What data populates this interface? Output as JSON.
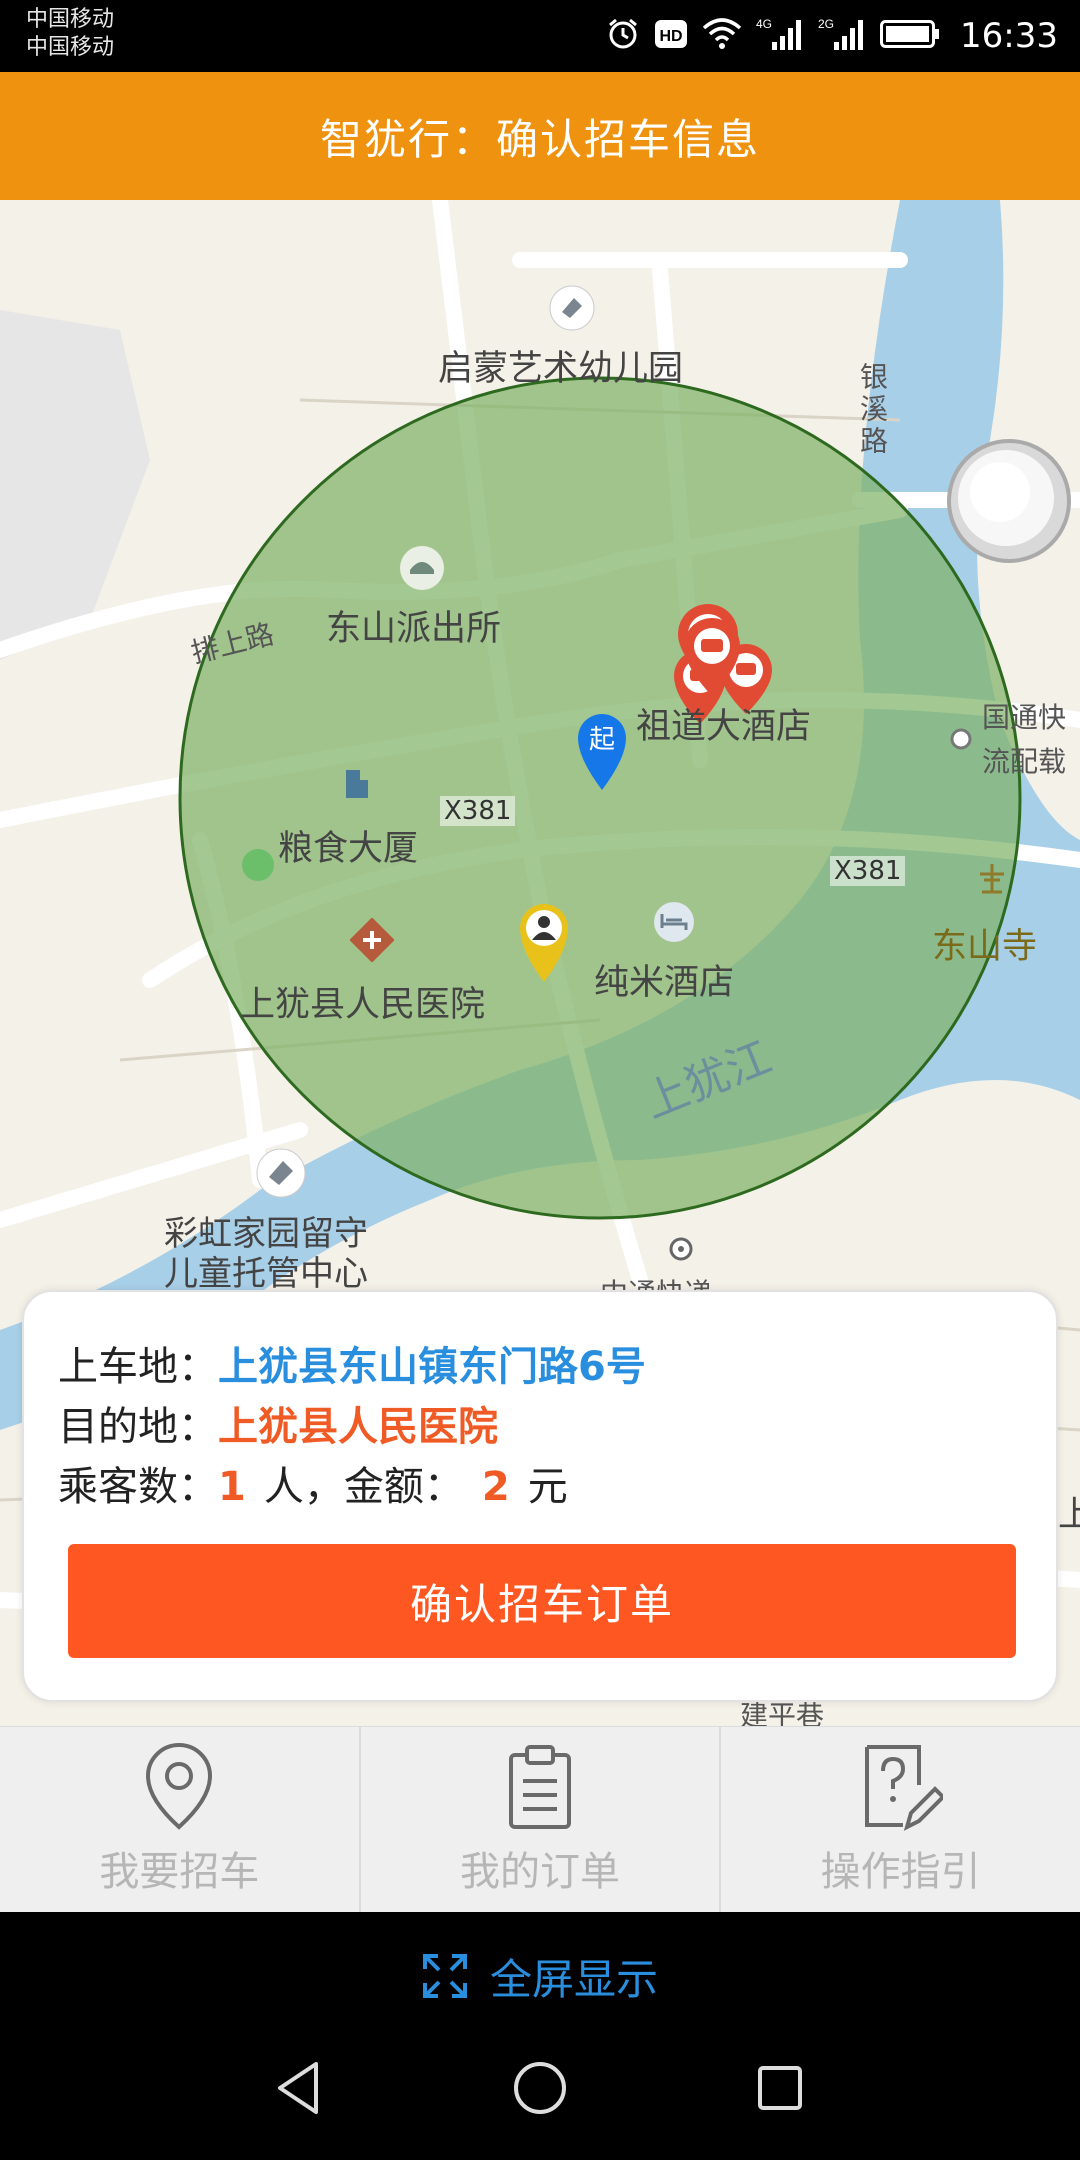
{
  "status_bar": {
    "carrier_1": "中国移动",
    "carrier_2": "中国移动",
    "network_1": "4G",
    "network_2": "2G",
    "hd": "HD",
    "time": "16:33"
  },
  "header": {
    "title": "智犹行：确认招车信息"
  },
  "map": {
    "labels": {
      "kindergarten": "启蒙艺术幼儿园",
      "yinxi_road": "银溪路",
      "paishang_road": "排上路",
      "police": "东山派出所",
      "hotel_zudao": "祖道大酒店",
      "guotong": "国通快",
      "guotong_2": "流配载",
      "x381_left": "X381",
      "x381_right": "X381",
      "grain": "粮食大厦",
      "dongshan_temple": "东山寺",
      "hospital": "上犹县人民医院",
      "chunmi": "纯米酒店",
      "river": "上犹江",
      "caihong": "彩虹家园留守",
      "caihong_2": "儿童托管中心",
      "courier": "中通快递",
      "jianping": "建平巷",
      "shang_right": "上"
    },
    "start_marker": "起",
    "colors": {
      "circle_fill": "#7fb368",
      "circle_stroke": "#2d6a1f",
      "river": "#a8cfe8",
      "marker_blue": "#1677e8",
      "marker_red": "#e14b34"
    }
  },
  "order": {
    "pickup_label": "上车地：",
    "pickup_value": "上犹县东山镇东门路6号",
    "destination_label": "目的地：",
    "destination_value": "上犹县人民医院",
    "passengers_label": "乘客数：",
    "passengers_value": "1",
    "passengers_unit": "人，金额：",
    "amount_value": "2",
    "amount_unit": "元",
    "confirm_button": "确认招车订单"
  },
  "bottom_nav": {
    "items": [
      {
        "label": "我要招车",
        "icon": "location-pin-icon"
      },
      {
        "label": "我的订单",
        "icon": "clipboard-icon"
      },
      {
        "label": "操作指引",
        "icon": "help-doc-icon"
      }
    ]
  },
  "fullscreen": {
    "label": "全屏显示",
    "icon": "fullscreen-icon"
  }
}
